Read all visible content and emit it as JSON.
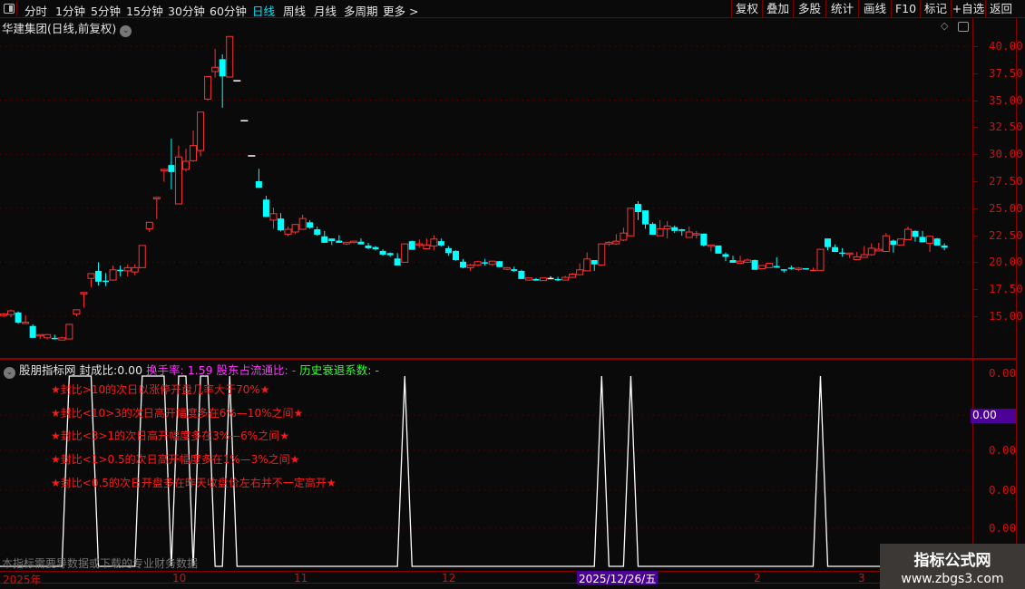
{
  "toolbar": {
    "periods": [
      "分时",
      "1分钟",
      "5分钟",
      "15分钟",
      "30分钟",
      "60分钟",
      "日线",
      "周线",
      "月线",
      "多周期",
      "更多 >"
    ],
    "active_period": "日线",
    "right_buttons": [
      "复权",
      "叠加",
      "多股",
      "统计",
      "画线",
      "F10",
      "标记",
      "+自选",
      "返回"
    ]
  },
  "chart": {
    "title": "华建集团(日线,前复权)"
  },
  "price_axis": {
    "labels": [
      "40.00",
      "37.50",
      "35.00",
      "32.50",
      "30.00",
      "27.50",
      "25.00",
      "22.50",
      "20.00",
      "17.50",
      "15.00"
    ]
  },
  "indicator": {
    "name": "股朋指标网",
    "seal_label": "封成比:",
    "seal_value": "0.00",
    "turnover": "换手率: 1.59",
    "holder_ratio": "股东占流通比: -",
    "decline": "历史衰退系数: -",
    "notes": [
      "★封比>10的次日以涨停开盘几率大于70%★",
      "★封比<10>3的次日高开幅度多在6%—10%之间★",
      "★封比<3>1的次日高开幅度多在3%—6%之间★",
      "★封比<1>0.5的次日高开幅度多在1%—3%之间★",
      "★封比<0.5的次日开盘多在昨天收盘价左右并不一定高开★"
    ],
    "axis_labels": [
      "0.00",
      "0.00",
      "0.00",
      "0.00"
    ],
    "cursor_value": "0.00",
    "warning": "本指标需要导数据或下载的专业财务数据"
  },
  "date_axis": {
    "labels": [
      "2025年",
      "10",
      "11",
      "12",
      "2",
      "3"
    ],
    "cursor_date": "2025/12/26/五"
  },
  "watermark": {
    "title": "指标公式网",
    "url": "www.zbgs3.com"
  },
  "colors": {
    "up": "#ff3232",
    "down": "#00ffff",
    "flat": "#ffffff",
    "axis": "#d01010",
    "grid": "#6a0000",
    "highlight": "#4b0096"
  },
  "chart_data": {
    "type": "candlestick",
    "y_range": [
      12,
      41.5
    ],
    "ohlc": [
      [
        15.1,
        15.3,
        14.9,
        15.2
      ],
      [
        15.15,
        15.6,
        14.9,
        15.5
      ],
      [
        15.35,
        15.45,
        14.3,
        14.4
      ],
      [
        14.4,
        15.1,
        14.35,
        14.45
      ],
      [
        14.1,
        14.25,
        13.0,
        13.0
      ],
      [
        13.2,
        13.3,
        12.9,
        13.3
      ],
      [
        13.0,
        13.35,
        12.85,
        13.3
      ],
      [
        13.0,
        13.3,
        12.85,
        12.9
      ],
      [
        12.8,
        13.1,
        12.8,
        13.0
      ],
      [
        12.9,
        14.3,
        12.9,
        14.25
      ],
      [
        15.2,
        15.6,
        15.0,
        15.6
      ],
      [
        17.1,
        17.2,
        15.8,
        17.2
      ],
      [
        18.5,
        18.95,
        17.7,
        18.95
      ],
      [
        19.2,
        20.0,
        17.85,
        18.2
      ],
      [
        18.3,
        19.0,
        17.8,
        18.2
      ],
      [
        18.35,
        19.7,
        18.3,
        19.3
      ],
      [
        19.3,
        19.7,
        18.7,
        19.2
      ],
      [
        19.2,
        19.8,
        18.7,
        19.5
      ],
      [
        19.1,
        19.8,
        18.8,
        19.5
      ],
      [
        19.5,
        21.55,
        19.5,
        21.55
      ],
      [
        23.1,
        23.7,
        22.8,
        23.7
      ],
      [
        25.9,
        26.0,
        24.0,
        26.0
      ],
      [
        28.5,
        28.6,
        27.45,
        28.6
      ],
      [
        29.0,
        31.45,
        26.75,
        28.35
      ],
      [
        25.4,
        30.8,
        25.4,
        29.75
      ],
      [
        28.6,
        30.5,
        28.4,
        29.35
      ],
      [
        29.4,
        32.2,
        29.3,
        30.8
      ],
      [
        30.35,
        33.9,
        29.8,
        33.9
      ],
      [
        35.1,
        37.2,
        35.0,
        37.2
      ],
      [
        37.65,
        39.75,
        37.1,
        38.05
      ],
      [
        38.8,
        39.25,
        34.3,
        37.2
      ],
      [
        37.15,
        40.9,
        37.1,
        40.9
      ],
      [
        36.8,
        36.8,
        36.8,
        36.8
      ],
      [
        33.1,
        33.1,
        33.1,
        33.1
      ],
      [
        29.85,
        29.85,
        29.85,
        29.85
      ],
      [
        27.5,
        28.65,
        26.9,
        26.9
      ],
      [
        25.8,
        26.15,
        24.2,
        24.2
      ],
      [
        23.9,
        25.05,
        23.1,
        24.5
      ],
      [
        24.05,
        24.55,
        22.85,
        22.95
      ],
      [
        22.6,
        23.3,
        22.4,
        23.05
      ],
      [
        22.8,
        23.55,
        22.6,
        23.5
      ],
      [
        23.05,
        24.4,
        23.0,
        24.05
      ],
      [
        23.7,
        23.9,
        23.1,
        23.2
      ],
      [
        23.05,
        23.3,
        22.45,
        22.55
      ],
      [
        22.4,
        22.9,
        21.8,
        21.8
      ],
      [
        22.2,
        22.2,
        21.6,
        21.95
      ],
      [
        22.0,
        22.5,
        21.8,
        21.8
      ],
      [
        21.7,
        21.9,
        21.6,
        21.85
      ],
      [
        21.85,
        22.0,
        21.75,
        21.95
      ],
      [
        21.9,
        22.2,
        21.65,
        21.65
      ],
      [
        21.55,
        21.8,
        21.2,
        21.3
      ],
      [
        21.4,
        21.5,
        21.1,
        21.2
      ],
      [
        21.05,
        21.2,
        20.6,
        20.7
      ],
      [
        20.85,
        20.9,
        20.5,
        20.65
      ],
      [
        20.35,
        20.85,
        19.7,
        19.7
      ],
      [
        20.0,
        21.75,
        20.0,
        21.7
      ],
      [
        21.95,
        22.0,
        21.15,
        21.15
      ],
      [
        21.6,
        22.1,
        21.35,
        21.7
      ],
      [
        21.25,
        22.2,
        21.2,
        21.6
      ],
      [
        21.5,
        22.5,
        21.1,
        22.15
      ],
      [
        21.95,
        22.2,
        21.45,
        21.55
      ],
      [
        21.3,
        21.5,
        20.6,
        20.85
      ],
      [
        21.05,
        21.1,
        20.15,
        20.2
      ],
      [
        20.05,
        20.3,
        19.45,
        19.5
      ],
      [
        19.5,
        19.85,
        19.2,
        19.75
      ],
      [
        19.75,
        20.15,
        19.7,
        20.05
      ],
      [
        20.0,
        20.3,
        19.7,
        19.95
      ],
      [
        19.8,
        20.1,
        19.7,
        20.1
      ],
      [
        20.1,
        20.1,
        19.55,
        19.55
      ],
      [
        19.35,
        19.5,
        19.25,
        19.5
      ],
      [
        19.35,
        19.6,
        19.1,
        19.2
      ],
      [
        19.2,
        19.3,
        18.45,
        18.45
      ],
      [
        18.35,
        18.55,
        18.3,
        18.55
      ],
      [
        18.45,
        18.55,
        18.3,
        18.3
      ],
      [
        18.3,
        18.55,
        18.3,
        18.55
      ],
      [
        18.55,
        18.7,
        18.5,
        18.55
      ],
      [
        18.45,
        18.65,
        18.25,
        18.4
      ],
      [
        18.35,
        18.75,
        18.3,
        18.6
      ],
      [
        18.6,
        19.0,
        18.55,
        18.9
      ],
      [
        18.85,
        19.9,
        18.8,
        19.3
      ],
      [
        19.2,
        20.9,
        19.2,
        20.3
      ],
      [
        20.2,
        20.2,
        19.2,
        19.8
      ],
      [
        19.75,
        21.7,
        19.75,
        21.7
      ],
      [
        21.7,
        21.95,
        21.5,
        21.85
      ],
      [
        21.7,
        22.6,
        21.6,
        21.95
      ],
      [
        22.05,
        23.2,
        21.95,
        22.7
      ],
      [
        22.45,
        25.0,
        22.4,
        25.0
      ],
      [
        25.4,
        25.65,
        23.9,
        24.65
      ],
      [
        24.8,
        24.8,
        23.1,
        23.5
      ],
      [
        23.55,
        23.7,
        22.55,
        22.55
      ],
      [
        22.45,
        23.9,
        22.45,
        23.1
      ],
      [
        23.1,
        23.8,
        22.2,
        23.35
      ],
      [
        23.25,
        23.4,
        22.7,
        22.9
      ],
      [
        23.05,
        23.1,
        22.45,
        22.9
      ],
      [
        22.3,
        23.3,
        22.3,
        22.8
      ],
      [
        22.55,
        22.9,
        22.2,
        22.65
      ],
      [
        22.65,
        22.65,
        21.45,
        21.55
      ],
      [
        21.5,
        21.6,
        21.0,
        21.6
      ],
      [
        21.55,
        21.55,
        20.8,
        20.8
      ],
      [
        20.75,
        20.9,
        20.1,
        20.5
      ],
      [
        20.2,
        20.6,
        19.95,
        19.95
      ],
      [
        19.9,
        20.6,
        19.85,
        20.1
      ],
      [
        20.0,
        20.35,
        19.95,
        20.2
      ],
      [
        20.2,
        20.25,
        19.3,
        19.3
      ],
      [
        19.4,
        19.7,
        19.4,
        19.7
      ],
      [
        19.5,
        19.95,
        19.5,
        19.9
      ],
      [
        19.65,
        20.45,
        19.5,
        19.5
      ],
      [
        19.35,
        19.35,
        19.05,
        19.25
      ],
      [
        19.5,
        19.7,
        19.3,
        19.45
      ],
      [
        19.35,
        19.55,
        19.2,
        19.45
      ],
      [
        19.45,
        19.45,
        19.35,
        19.35
      ],
      [
        19.3,
        19.5,
        19.25,
        19.3
      ],
      [
        19.25,
        21.2,
        19.25,
        21.2
      ],
      [
        22.2,
        22.2,
        21.1,
        21.4
      ],
      [
        21.4,
        21.65,
        20.95,
        20.95
      ],
      [
        20.9,
        21.3,
        20.5,
        20.85
      ],
      [
        20.8,
        20.85,
        20.4,
        20.85
      ],
      [
        20.25,
        20.95,
        20.25,
        20.5
      ],
      [
        20.45,
        21.5,
        20.45,
        20.7
      ],
      [
        20.7,
        21.75,
        20.6,
        21.3
      ],
      [
        21.05,
        21.8,
        21.05,
        21.2
      ],
      [
        21.0,
        22.7,
        21.0,
        22.45
      ],
      [
        22.0,
        22.1,
        20.9,
        21.6
      ],
      [
        21.6,
        22.2,
        21.6,
        22.15
      ],
      [
        22.1,
        23.3,
        22.1,
        23.05
      ],
      [
        22.9,
        22.95,
        21.9,
        22.35
      ],
      [
        22.35,
        22.9,
        21.85,
        21.85
      ],
      [
        21.75,
        22.45,
        20.95,
        22.4
      ],
      [
        22.2,
        22.25,
        21.55,
        21.55
      ],
      [
        21.55,
        21.75,
        21.1,
        21.35
      ]
    ],
    "indicator_high_days": [
      9,
      10,
      11,
      12,
      19,
      20,
      21,
      22,
      24,
      25,
      27,
      28,
      31,
      55,
      82,
      86,
      112
    ]
  }
}
